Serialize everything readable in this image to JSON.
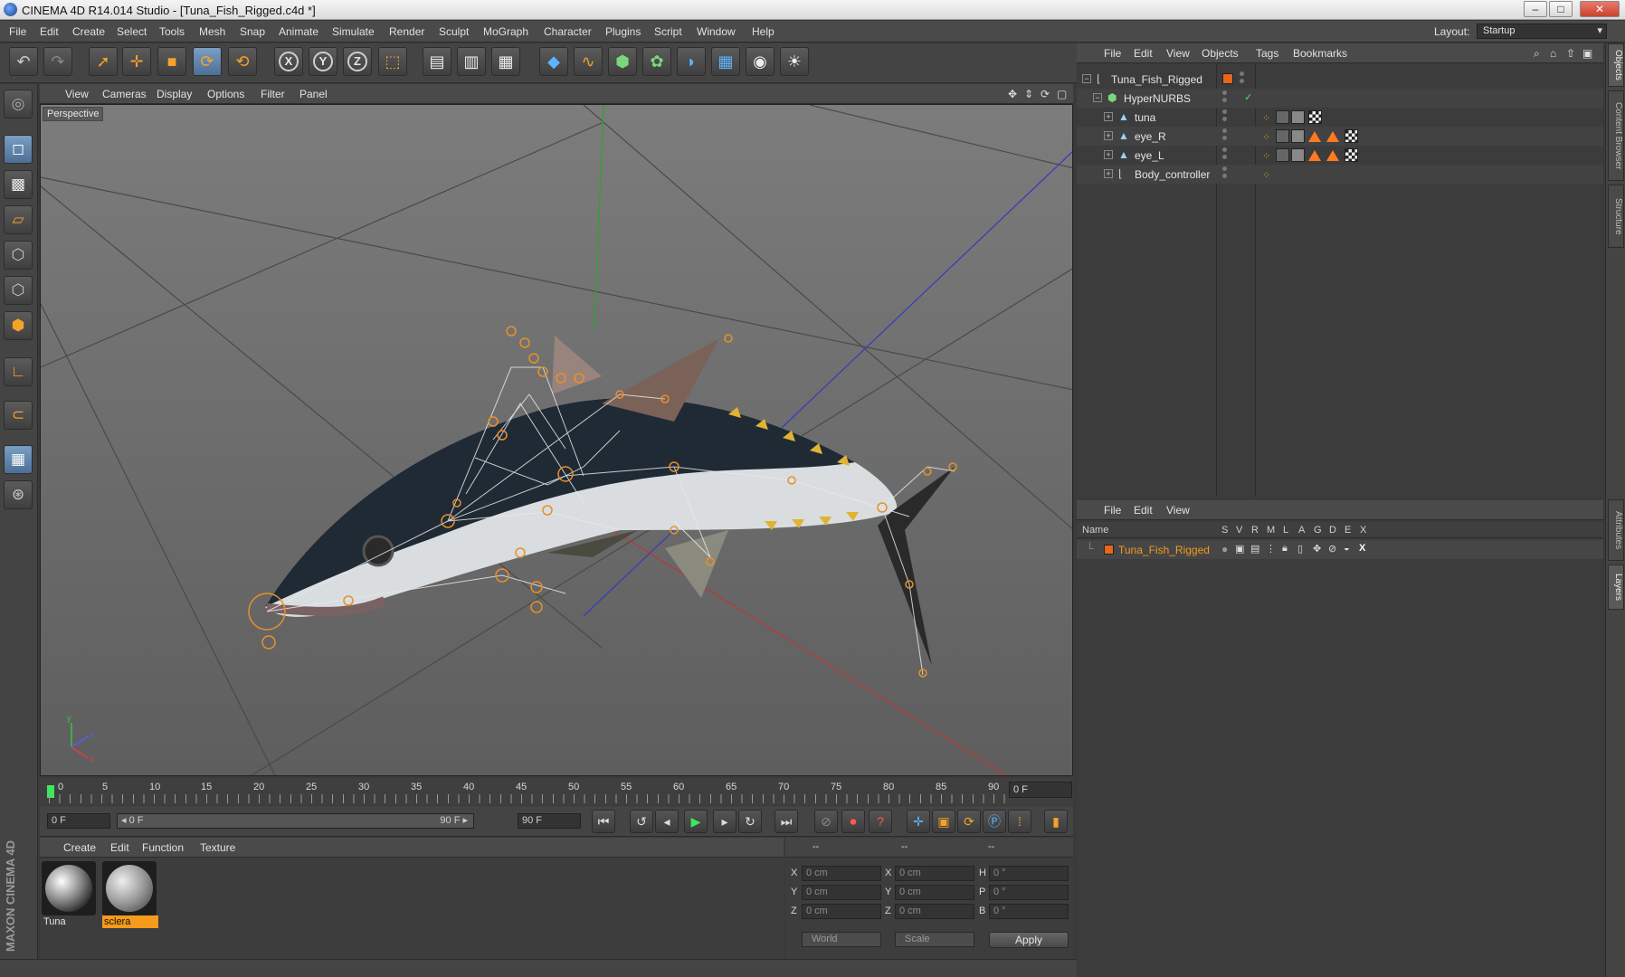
{
  "window": {
    "title": "CINEMA 4D R14.014 Studio - [Tuna_Fish_Rigged.c4d *]",
    "minimize": "–",
    "maximize": "□",
    "close": "✕"
  },
  "menu": [
    "File",
    "Edit",
    "Create",
    "Select",
    "Tools",
    "Mesh",
    "Snap",
    "Animate",
    "Simulate",
    "Render",
    "Sculpt",
    "MoGraph",
    "Character",
    "Plugins",
    "Script",
    "Window",
    "Help"
  ],
  "layout": {
    "label": "Layout:",
    "value": "Startup"
  },
  "viewport": {
    "menu": [
      "View",
      "Cameras",
      "Display",
      "Options",
      "Filter",
      "Panel"
    ],
    "label": "Perspective"
  },
  "timeline": {
    "ticks": [
      "0",
      "5",
      "10",
      "15",
      "20",
      "25",
      "30",
      "35",
      "40",
      "45",
      "50",
      "55",
      "60",
      "65",
      "70",
      "75",
      "80",
      "85",
      "90"
    ],
    "current_frame": "0 F"
  },
  "transport": {
    "start_field": "0 F",
    "range_start": "◂ 0 F",
    "range_end": "90 F ▸",
    "end_field": "90 F"
  },
  "materials": {
    "menu": [
      "Create",
      "Edit",
      "Function",
      "Texture"
    ],
    "items": [
      {
        "name": "Tuna",
        "selected": false
      },
      {
        "name": "sclera",
        "selected": true
      }
    ]
  },
  "coordinates": {
    "headers": [
      "--",
      "--",
      "--"
    ],
    "rows": [
      {
        "l1": "X",
        "v1": "0 cm",
        "l2": "X",
        "v2": "0 cm",
        "l3": "H",
        "v3": "0 °"
      },
      {
        "l1": "Y",
        "v1": "0 cm",
        "l2": "Y",
        "v2": "0 cm",
        "l3": "P",
        "v3": "0 °"
      },
      {
        "l1": "Z",
        "v1": "0 cm",
        "l2": "Z",
        "v2": "0 cm",
        "l3": "B",
        "v3": "0 °"
      }
    ],
    "mode": "World",
    "transform": "Scale",
    "apply": "Apply"
  },
  "object_manager": {
    "menu": [
      "File",
      "Edit",
      "View",
      "Objects",
      "Tags",
      "Bookmarks"
    ],
    "objects": [
      {
        "name": "Tuna_Fish_Rigged",
        "icon": "null-icon"
      },
      {
        "name": "HyperNURBS",
        "icon": "hypernurbs-icon"
      },
      {
        "name": "tuna",
        "icon": "polygon-icon"
      },
      {
        "name": "eye_R",
        "icon": "polygon-icon"
      },
      {
        "name": "eye_L",
        "icon": "polygon-icon"
      },
      {
        "name": "Body_controller",
        "icon": "null-icon"
      }
    ]
  },
  "layer_manager": {
    "menu": [
      "File",
      "Edit",
      "View"
    ],
    "columns": [
      "Name",
      "S",
      "V",
      "R",
      "M",
      "L",
      "A",
      "G",
      "D",
      "E",
      "X"
    ],
    "layers": [
      {
        "name": "Tuna_Fish_Rigged",
        "color": "#e8651c"
      }
    ]
  },
  "side_tabs": [
    "Objects",
    "Content Browser",
    "Structure",
    "Attributes",
    "Layers"
  ],
  "brand": "MAXON CINEMA 4D",
  "colors": {
    "accent": "#f59a1a",
    "selection": "#f4a22a",
    "bg": "#3a3a3a"
  }
}
